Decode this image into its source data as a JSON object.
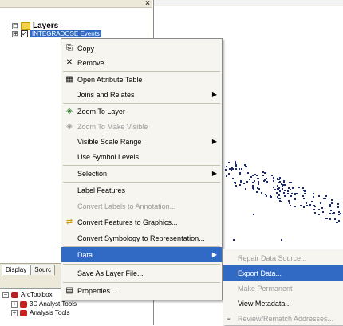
{
  "toc": {
    "layers_label": "Layers",
    "layer_name": "INTEGRADOSE Events",
    "close_glyph": "×",
    "expand_glyph": "⊟",
    "collapse_glyph": "⊞",
    "check_glyph": "✓"
  },
  "tabs": [
    {
      "label": "Display"
    },
    {
      "label": "Sourc"
    }
  ],
  "arctoolbox": {
    "root": "ArcToolbox",
    "items": [
      "3D Analyst Tools",
      "Analysis Tools"
    ]
  },
  "context_menu": {
    "items": [
      {
        "label": "Copy",
        "icon": "copy-icon",
        "glyph": "⎘"
      },
      {
        "label": "Remove",
        "icon": "remove-icon",
        "glyph": "✕"
      },
      {
        "label": "Open Attribute Table",
        "icon": "table-icon",
        "glyph": "▦"
      },
      {
        "label": "Joins and Relates",
        "arrow": "▶"
      },
      {
        "label": "Zoom To Layer",
        "icon": "zoom-layer-icon",
        "glyph": "◈"
      },
      {
        "label": "Zoom To Make Visible",
        "icon": "zoom-visible-icon",
        "glyph": "◈",
        "disabled": true
      },
      {
        "label": "Visible Scale Range",
        "arrow": "▶"
      },
      {
        "label": "Use Symbol Levels"
      },
      {
        "label": "Selection",
        "arrow": "▶"
      },
      {
        "label": "Label Features"
      },
      {
        "label": "Convert Labels to Annotation...",
        "disabled": true
      },
      {
        "label": "Convert Features to Graphics...",
        "icon": "convert-icon",
        "glyph": "⇄"
      },
      {
        "label": "Convert Symbology to Representation..."
      },
      {
        "label": "Data",
        "arrow": "▶",
        "highlight": true
      },
      {
        "label": "Save As Layer File..."
      },
      {
        "label": "Properties...",
        "icon": "properties-icon",
        "glyph": "▤"
      }
    ]
  },
  "data_submenu": {
    "items": [
      {
        "label": "Repair Data Source...",
        "disabled": true
      },
      {
        "label": "Export Data...",
        "highlight": true
      },
      {
        "label": "Make Permanent",
        "disabled": true
      },
      {
        "label": "View Metadata..."
      },
      {
        "label": "Review/Rematch Addresses...",
        "disabled": true,
        "icon": "review-icon",
        "glyph": "◒"
      }
    ]
  },
  "colors": {
    "highlight": "#316ac5",
    "menu_bg": "#f6f5f0",
    "point": "#1c2a6e"
  }
}
